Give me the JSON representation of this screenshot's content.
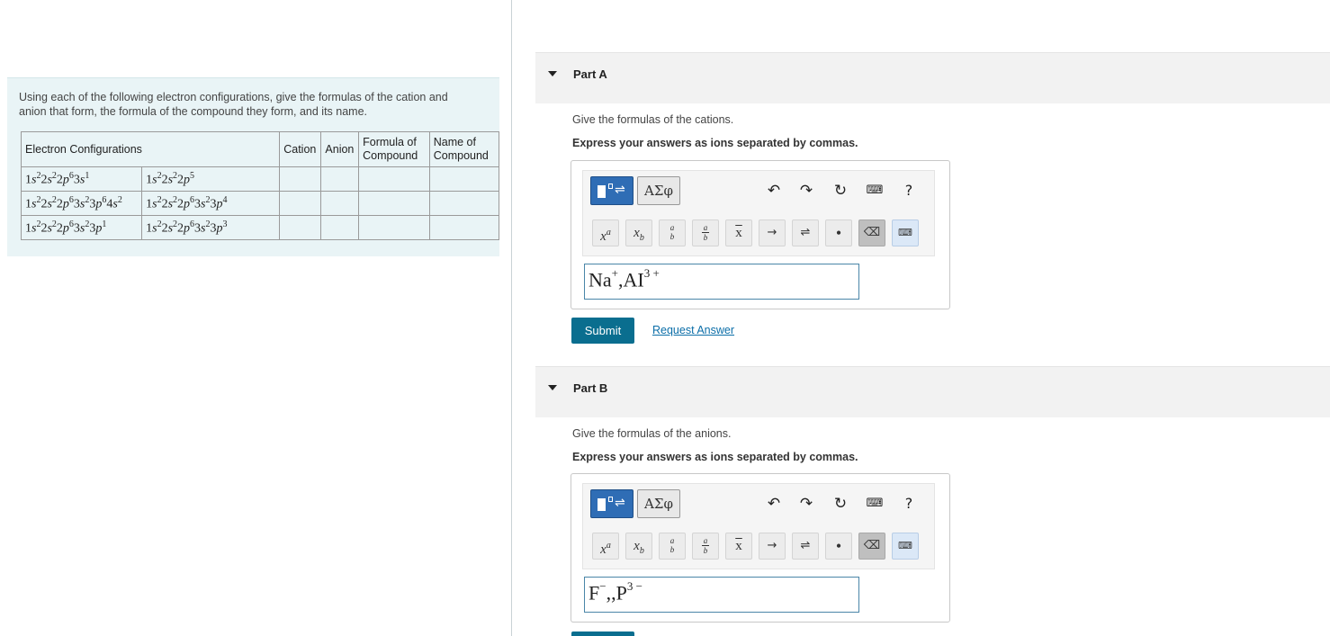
{
  "intro": {
    "text": "Using each of the following electron configurations, give the formulas of the cation and anion that form, the formula of the compound they form, and its name.",
    "table": {
      "headers": {
        "electron_configurations": "Electron Configurations",
        "cation": "Cation",
        "anion": "Anion",
        "formula_line1": "Formula of",
        "formula_line2": "Compound",
        "name_line1": "Name of",
        "name_line2": "Compound"
      }
    }
  },
  "part_a": {
    "title": "Part A",
    "question": "Give the formulas of the cations.",
    "instruction": "Express your answers as ions separated by commas.",
    "answer": {
      "ion1": "Na",
      "ion1_charge": "+",
      "sep": ",",
      "ion2": "AI",
      "ion2_charge": "3 +"
    },
    "submit_label": "Submit",
    "request_label": "Request Answer"
  },
  "part_b": {
    "title": "Part B",
    "question": "Give the formulas of the anions.",
    "instruction": "Express your answers as ions separated by commas.",
    "answer": {
      "ion1": "F",
      "ion1_charge": "−",
      "sep": ",,",
      "ion2": "P",
      "ion2_charge": "3 −"
    }
  },
  "toolbar": {
    "greek_label": "ΑΣφ",
    "help_label": "?",
    "icons": [
      "templates-icon",
      "greek-icon",
      "undo-icon",
      "redo-icon",
      "reset-icon",
      "keyboard-icon",
      "help-icon"
    ],
    "symbols": [
      "superscript",
      "subscript",
      "fraction",
      "small-fraction",
      "overline",
      "reaction-arrow",
      "equilibrium-arrow",
      "dot",
      "delete",
      "keyboard-toggle"
    ]
  }
}
